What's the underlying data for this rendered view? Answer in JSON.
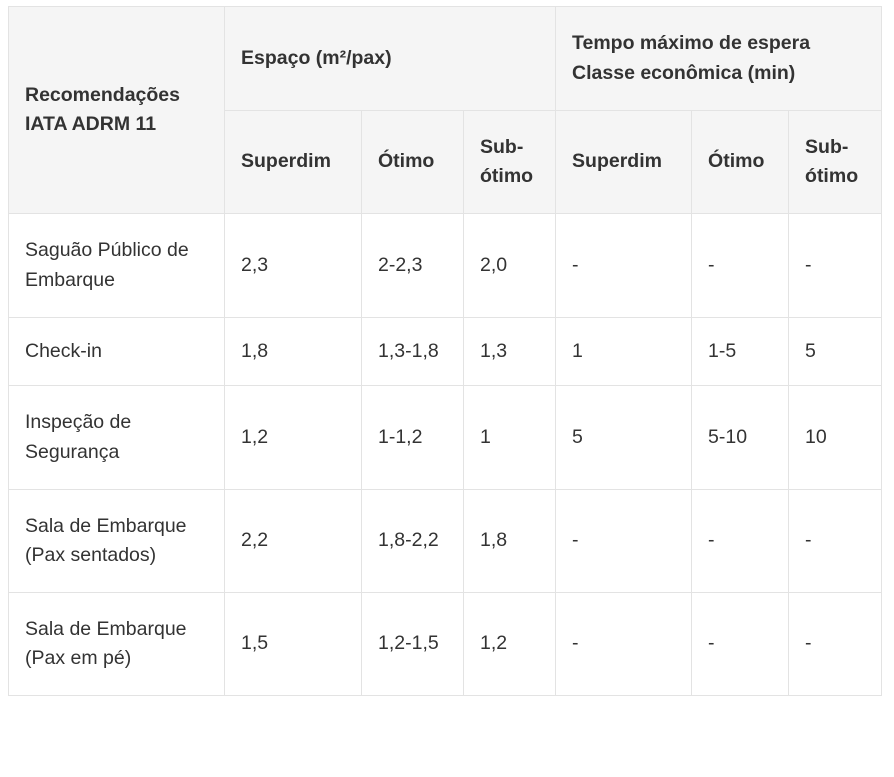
{
  "table": {
    "header": {
      "recommendations": "Recomendações IATA ADRM 11",
      "space_group": "Espaço (m²/pax)",
      "wait_group": "Tempo máximo de espera Classe econômica (min)",
      "sub_columns": [
        "Superdim",
        "Ótimo",
        "Sub-ótimo",
        "Superdim",
        "Ótimo",
        "Sub-ótimo"
      ]
    },
    "rows": [
      {
        "label": "Saguão Público de Embarque",
        "cells": [
          "2,3",
          "2-2,3",
          "2,0",
          "-",
          "-",
          "-"
        ]
      },
      {
        "label": "Check-in",
        "cells": [
          "1,8",
          "1,3-1,8",
          "1,3",
          "1",
          "1-5",
          "5"
        ]
      },
      {
        "label": "Inspeção de Segurança",
        "cells": [
          "1,2",
          "1-1,2",
          "1",
          "5",
          "5-10",
          "10"
        ]
      },
      {
        "label": "Sala de Embarque (Pax sentados)",
        "cells": [
          "2,2",
          "1,8-2,2",
          "1,8",
          "-",
          "-",
          "-"
        ]
      },
      {
        "label": "Sala de Embarque (Pax em pé)",
        "cells": [
          "1,5",
          "1,2-1,5",
          "1,2",
          "-",
          "-",
          "-"
        ]
      }
    ]
  }
}
